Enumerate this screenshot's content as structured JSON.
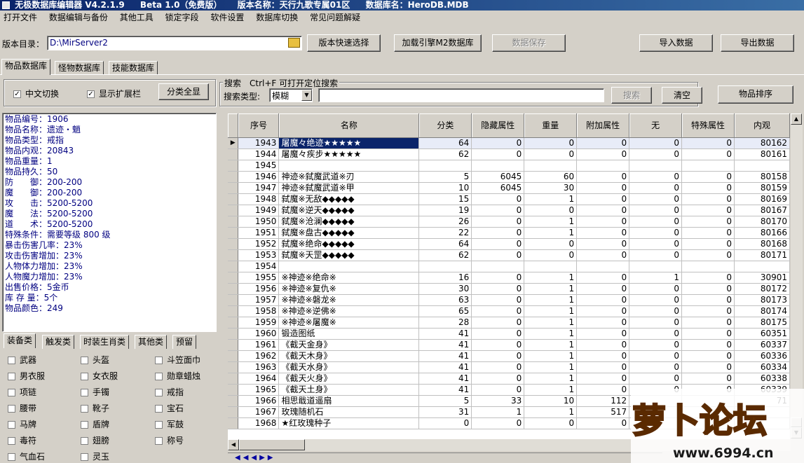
{
  "titlebar": {
    "app": "无极数据库编辑器 V4.2.1.9",
    "beta": "Beta 1.0（免费版）",
    "version_name": "版本名称：天行九歌专属01区",
    "db_name": "数据库名：HeroDB.MDB"
  },
  "menu": [
    "打开文件",
    "数据编辑与备份",
    "其他工具",
    "锁定字段",
    "软件设置",
    "数据库切换",
    "常见问题解疑"
  ],
  "toolbar": {
    "dir_label": "版本目录：",
    "dir_value": "D:\\MirServer2",
    "quick_select": "版本快速选择",
    "load_engine": "加载引擎M2数据库",
    "save_data": "数据保存",
    "import_data": "导入数据",
    "export_data": "导出数据"
  },
  "main_tabs": [
    "物品数据库",
    "怪物数据库",
    "技能数据库"
  ],
  "options": {
    "chinese_switch": "中文切换",
    "show_extend": "显示扩展栏",
    "show_all": "分类全显"
  },
  "search": {
    "group_title": "搜索　Ctrl+F 可打开定位搜索",
    "type_label": "搜索类型:",
    "type_value": "模糊",
    "search_button": "搜索",
    "clear_button": "清空",
    "sort_button": "物品排序"
  },
  "item_info": [
    "物品编号：1906",
    "物品名称：遗迹・魈",
    "物品类型：戒指",
    "物品内观：20843",
    "物品重量：1",
    "物品持久：50",
    "防　　御：200-200",
    "魔　　御：200-200",
    "攻　　击：5200-5200",
    "魔　　法：5200-5200",
    "道　　术：5200-5200",
    "特殊条件：需要等级 800 级",
    "暴击伤害几率：23%",
    "攻击伤害增加：23%",
    "人物体力增加：23%",
    "人物魔力增加：23%",
    "出售价格：5金币",
    "库 存 量：5个",
    "物品颜色：249"
  ],
  "category_tabs": [
    "装备类",
    "触发类",
    "时装生肖类",
    "其他类",
    "预留"
  ],
  "categories": [
    [
      "武器",
      "头盔",
      "斗笠面巾"
    ],
    [
      "男衣服",
      "女衣服",
      "勋章蜡烛"
    ],
    [
      "项链",
      "手镯",
      "戒指"
    ],
    [
      "腰带",
      "靴子",
      "宝石"
    ],
    [
      "马牌",
      "盾牌",
      "军鼓"
    ],
    [
      "毒符",
      "翅膀",
      "称号"
    ],
    [
      "气血石",
      "灵玉",
      ""
    ]
  ],
  "grid": {
    "columns": [
      "序号",
      "名称",
      "分类",
      "隐藏属性",
      "重量",
      "附加属性",
      "无",
      "特殊属性",
      "内观"
    ],
    "rows": [
      [
        "1943",
        "屠魔々绝迹★★★★★",
        "64",
        "0",
        "0",
        "0",
        "0",
        "0",
        "80162"
      ],
      [
        "1944",
        "屠魔々疾步★★★★★",
        "62",
        "0",
        "0",
        "0",
        "0",
        "0",
        "80161"
      ],
      [
        "1945",
        "",
        "",
        "",
        "",
        "",
        "",
        "",
        ""
      ],
      [
        "1946",
        "神迹※弑魔武道※刃",
        "5",
        "6045",
        "60",
        "0",
        "0",
        "0",
        "80158"
      ],
      [
        "1947",
        "神迹※弑魔武道※甲",
        "10",
        "6045",
        "30",
        "0",
        "0",
        "0",
        "80159"
      ],
      [
        "1948",
        "弑魔※无敌◆◆◆◆◆",
        "15",
        "0",
        "1",
        "0",
        "0",
        "0",
        "80169"
      ],
      [
        "1949",
        "弑魔※逆天◆◆◆◆◆",
        "19",
        "0",
        "0",
        "0",
        "0",
        "0",
        "80167"
      ],
      [
        "1950",
        "弑魔※沧澜◆◆◆◆◆",
        "26",
        "0",
        "1",
        "0",
        "0",
        "0",
        "80170"
      ],
      [
        "1951",
        "弑魔※盘古◆◆◆◆◆",
        "22",
        "0",
        "1",
        "0",
        "0",
        "0",
        "80166"
      ],
      [
        "1952",
        "弑魔※绝命◆◆◆◆◆",
        "64",
        "0",
        "0",
        "0",
        "0",
        "0",
        "80168"
      ],
      [
        "1953",
        "弑魔※天罡◆◆◆◆◆",
        "62",
        "0",
        "0",
        "0",
        "0",
        "0",
        "80171"
      ],
      [
        "1954",
        "",
        "",
        "",
        "",
        "",
        "",
        "",
        ""
      ],
      [
        "1955",
        "※神迹※绝命※",
        "16",
        "0",
        "1",
        "0",
        "1",
        "0",
        "30901"
      ],
      [
        "1956",
        "※神迹※复仇※",
        "30",
        "0",
        "1",
        "0",
        "0",
        "0",
        "80172"
      ],
      [
        "1957",
        "※神迹※磐龙※",
        "63",
        "0",
        "1",
        "0",
        "0",
        "0",
        "80173"
      ],
      [
        "1958",
        "※神迹※逆佛※",
        "65",
        "0",
        "1",
        "0",
        "0",
        "0",
        "80174"
      ],
      [
        "1959",
        "※神迹※屠魔※",
        "28",
        "0",
        "1",
        "0",
        "0",
        "0",
        "80175"
      ],
      [
        "1960",
        "锻造图纸",
        "41",
        "0",
        "1",
        "0",
        "0",
        "0",
        "60351"
      ],
      [
        "1961",
        "《截天金身》",
        "41",
        "0",
        "1",
        "0",
        "0",
        "0",
        "60337"
      ],
      [
        "1962",
        "《截天木身》",
        "41",
        "0",
        "1",
        "0",
        "0",
        "0",
        "60336"
      ],
      [
        "1963",
        "《截天水身》",
        "41",
        "0",
        "1",
        "0",
        "0",
        "0",
        "60334"
      ],
      [
        "1964",
        "《截天火身》",
        "41",
        "0",
        "1",
        "0",
        "0",
        "0",
        "60338"
      ],
      [
        "1965",
        "《截天土身》",
        "41",
        "0",
        "1",
        "0",
        "0",
        "0",
        "60339"
      ],
      [
        "1966",
        "相思戢道遥扇",
        "5",
        "33",
        "10",
        "112",
        "",
        "",
        "71"
      ],
      [
        "1967",
        "玫瑰随机石",
        "31",
        "1",
        "1",
        "517",
        "",
        "",
        ""
      ],
      [
        "1968",
        "★红玫瑰种子",
        "0",
        "0",
        "0",
        "0",
        "",
        "",
        ""
      ]
    ]
  },
  "watermark": {
    "brand": "萝卜论坛",
    "url": "www.6994.cn"
  },
  "colors": {
    "title_start": "#0a246a",
    "title_end": "#3a6ea5",
    "info_text": "#000080",
    "selection": "#0a246a",
    "face": "#d4d0c8"
  }
}
